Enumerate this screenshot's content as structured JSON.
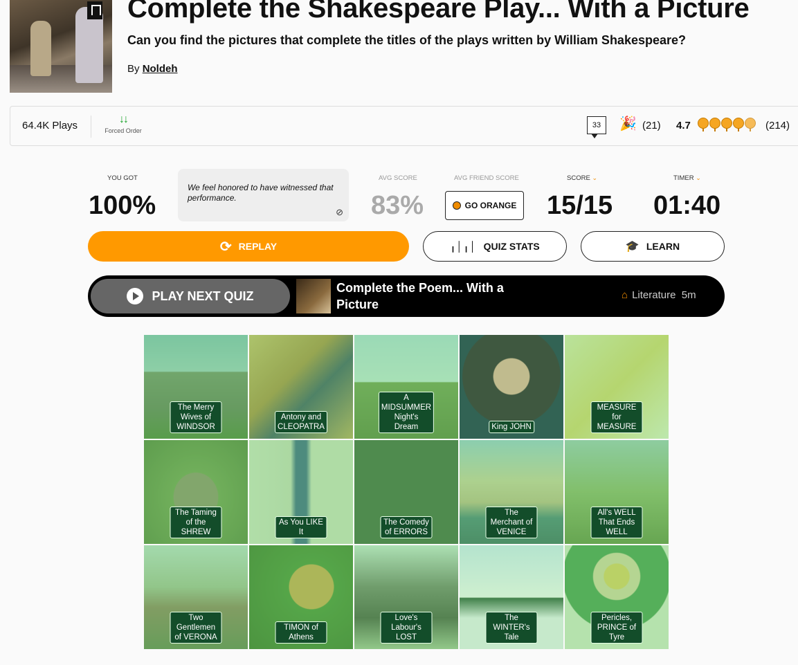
{
  "header": {
    "title": "Complete the Shakespeare Play... With a Picture",
    "subtitle": "Can you find the pictures that complete the titles of the plays written by William Shakespeare?",
    "by_label": "By",
    "author": "Noldeh"
  },
  "stats_bar": {
    "plays": "64.4K Plays",
    "forced_order": "Forced Order",
    "comments": "33",
    "reactions": "(21)",
    "rating": "4.7",
    "rating_count": "(214)",
    "rating_stars": 4.7
  },
  "results": {
    "you_got_label": "YOU GOT",
    "you_got": "100%",
    "message": "We feel honored to have witnessed that performance.",
    "avg_score_label": "AVG SCORE",
    "avg_score": "83%",
    "avg_friend_label": "AVG FRIEND SCORE",
    "go_orange": "GO ORANGE",
    "score_label": "SCORE",
    "score": "15/15",
    "timer_label": "TIMER",
    "timer": "01:40"
  },
  "actions": {
    "replay": "REPLAY",
    "quiz_stats": "QUIZ STATS",
    "learn": "LEARN"
  },
  "next_quiz": {
    "button": "PLAY NEXT QUIZ",
    "title": "Complete the Poem... With a Picture",
    "category": "Literature",
    "duration": "5m"
  },
  "tiles": [
    {
      "caption": "The Merry Wives of WINDSOR"
    },
    {
      "caption": "Antony and CLEOPATRA"
    },
    {
      "caption": "A MIDSUMMER Night's Dream"
    },
    {
      "caption": "King JOHN"
    },
    {
      "caption": "MEASURE for MEASURE"
    },
    {
      "caption": "The Taming of the SHREW"
    },
    {
      "caption": "As You LIKE It"
    },
    {
      "caption": "The Comedy of ERRORS"
    },
    {
      "caption": "The Merchant of VENICE"
    },
    {
      "caption": "All's WELL That Ends WELL"
    },
    {
      "caption": "Two Gentlemen of VERONA"
    },
    {
      "caption": "TIMON of Athens"
    },
    {
      "caption": "Love's Labour's LOST"
    },
    {
      "caption": "The WINTER's Tale"
    },
    {
      "caption": "Pericles, PRINCE of Tyre"
    }
  ],
  "colors": {
    "accent": "#ff9900",
    "correct_tint": "#78dc6e",
    "caption_bg": "#134d2a"
  }
}
